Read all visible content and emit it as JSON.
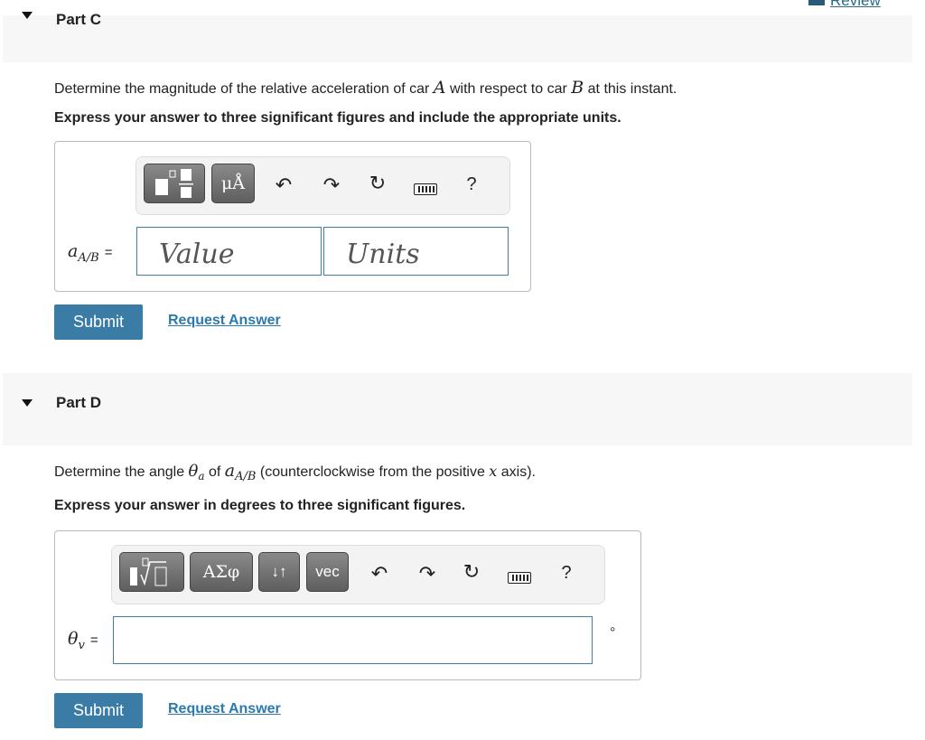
{
  "review_link": "Review",
  "part_c": {
    "title": "Part C",
    "question_pre": "Determine the magnitude of the relative acceleration of car ",
    "var_a": "A",
    "question_mid": " with respect to car ",
    "var_b": "B",
    "question_post": " at this instant.",
    "instruction": "Express your answer to three significant figures and include the appropriate units.",
    "toolbar": {
      "template_button": "templates",
      "units_button": "μÅ",
      "help": "?"
    },
    "label": "a",
    "label_sub": "A/B",
    "equals": "=",
    "value_placeholder": "Value",
    "units_placeholder": "Units",
    "submit": "Submit",
    "request": "Request Answer"
  },
  "part_d": {
    "title": "Part D",
    "question_pre": "Determine the angle ",
    "theta": "θ",
    "theta_sub": "a",
    "question_mid": " of ",
    "a": "a",
    "a_sub": "A/B",
    "question_post": " (counterclockwise from the positive ",
    "x": "x",
    "question_end": " axis).",
    "instruction": "Express your answer in degrees to three significant figures.",
    "toolbar": {
      "greek_button": "ΑΣφ",
      "arrows_button": "↓↑",
      "vec_button": "vec",
      "help": "?"
    },
    "label": "θ",
    "label_sub": "v",
    "equals": "=",
    "unit": "°",
    "submit": "Submit",
    "request": "Request Answer"
  }
}
